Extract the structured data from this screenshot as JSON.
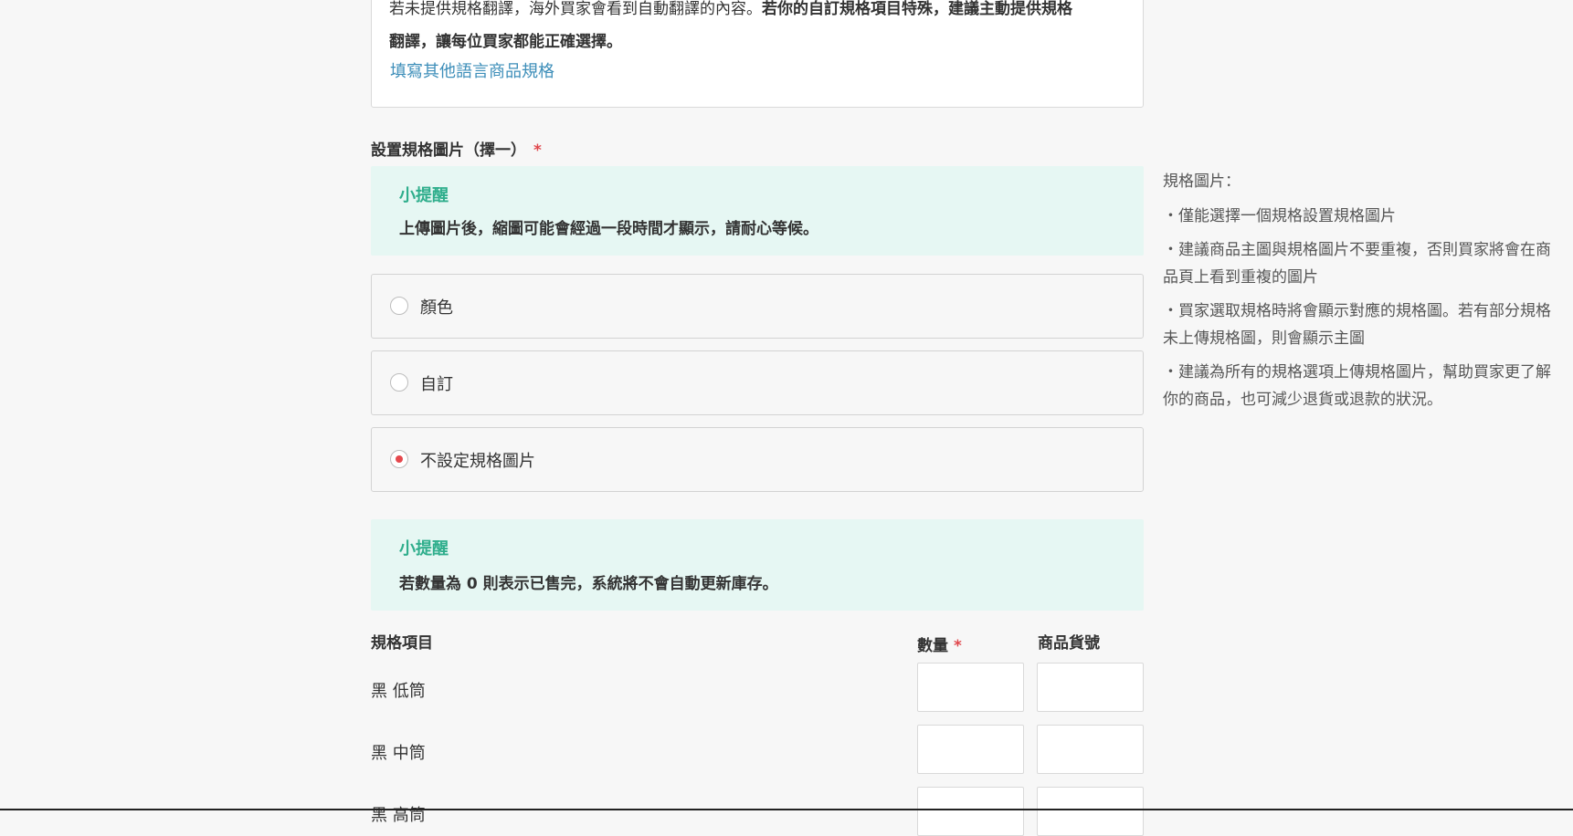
{
  "translation": {
    "line1_normal": "若未提供規格翻譯，海外買家會看到自動翻譯的內容。",
    "line1_bold": "若你的自訂規格項目特殊，建議主動提供規格",
    "line2_bold": "翻譯，讓每位買家都能正確選擇。",
    "link_label": "填寫其他語言商品規格"
  },
  "spec_image": {
    "label": "設置規格圖片（擇一）",
    "required_mark": "*",
    "tip": {
      "title": "小提醒",
      "body": "上傳圖片後，縮圖可能會經過一段時間才顯示，請耐心等候。"
    },
    "options": [
      {
        "label": "顏色",
        "checked": false
      },
      {
        "label": "自訂",
        "checked": false
      },
      {
        "label": "不設定規格圖片",
        "checked": true
      }
    ]
  },
  "help": {
    "title": "規格圖片：",
    "items": [
      "・僅能選擇一個規格設置規格圖片",
      "・建議商品主圖與規格圖片不要重複，否則買家將會在商品頁上看到重複的圖片",
      "・買家選取規格時將會顯示對應的規格圖。若有部分規格未上傳規格圖，則會顯示主圖",
      "・建議為所有的規格選項上傳規格圖片，幫助買家更了解你的商品，也可減少退貨或退款的狀況。"
    ]
  },
  "stock_tip": {
    "title": "小提醒",
    "body": "若數量為 0 則表示已售完，系統將不會自動更新庫存。"
  },
  "table": {
    "col_item": "規格項目",
    "col_qty": "數量",
    "col_qty_required": "*",
    "col_sku": "商品貨號",
    "rows": [
      {
        "label": "黑 低筒",
        "qty": "",
        "sku": ""
      },
      {
        "label": "黑 中筒",
        "qty": "",
        "sku": ""
      },
      {
        "label": "黑 高筒",
        "qty": "",
        "sku": ""
      }
    ]
  },
  "colors": {
    "link": "#3d8eb9",
    "tip_bg": "#e6f7f3",
    "tip_title": "#2fae8c",
    "required": "#e0474c",
    "radio_checked": "#e5484d"
  }
}
